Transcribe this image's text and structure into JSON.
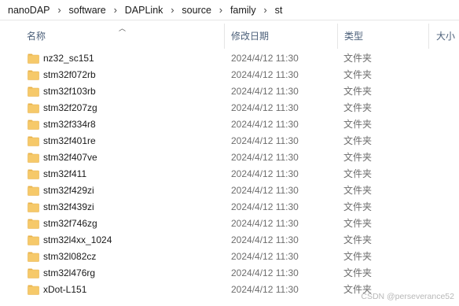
{
  "breadcrumb": [
    "nanoDAP",
    "software",
    "DAPLink",
    "source",
    "family",
    "st"
  ],
  "columns": {
    "name": "名称",
    "modified": "修改日期",
    "type": "类型",
    "size": "大小"
  },
  "files": [
    {
      "name": "nz32_sc151",
      "modified": "2024/4/12 11:30",
      "type": "文件夹"
    },
    {
      "name": "stm32f072rb",
      "modified": "2024/4/12 11:30",
      "type": "文件夹"
    },
    {
      "name": "stm32f103rb",
      "modified": "2024/4/12 11:30",
      "type": "文件夹"
    },
    {
      "name": "stm32f207zg",
      "modified": "2024/4/12 11:30",
      "type": "文件夹"
    },
    {
      "name": "stm32f334r8",
      "modified": "2024/4/12 11:30",
      "type": "文件夹"
    },
    {
      "name": "stm32f401re",
      "modified": "2024/4/12 11:30",
      "type": "文件夹"
    },
    {
      "name": "stm32f407ve",
      "modified": "2024/4/12 11:30",
      "type": "文件夹"
    },
    {
      "name": "stm32f411",
      "modified": "2024/4/12 11:30",
      "type": "文件夹"
    },
    {
      "name": "stm32f429zi",
      "modified": "2024/4/12 11:30",
      "type": "文件夹"
    },
    {
      "name": "stm32f439zi",
      "modified": "2024/4/12 11:30",
      "type": "文件夹"
    },
    {
      "name": "stm32f746zg",
      "modified": "2024/4/12 11:30",
      "type": "文件夹"
    },
    {
      "name": "stm32l4xx_1024",
      "modified": "2024/4/12 11:30",
      "type": "文件夹"
    },
    {
      "name": "stm32l082cz",
      "modified": "2024/4/12 11:30",
      "type": "文件夹"
    },
    {
      "name": "stm32l476rg",
      "modified": "2024/4/12 11:30",
      "type": "文件夹"
    },
    {
      "name": "xDot-L151",
      "modified": "2024/4/12 11:30",
      "type": "文件夹"
    }
  ],
  "watermark": "CSDN @perseverance52",
  "colors": {
    "folder_fill": "#f6c96a",
    "folder_tab": "#e8b24a",
    "header_text": "#4c607a",
    "meta_text": "#6d6d6d"
  },
  "icons": {
    "folder": "folder-icon",
    "separator": "chevron-right-icon",
    "sort": "sort-ascending-icon"
  }
}
